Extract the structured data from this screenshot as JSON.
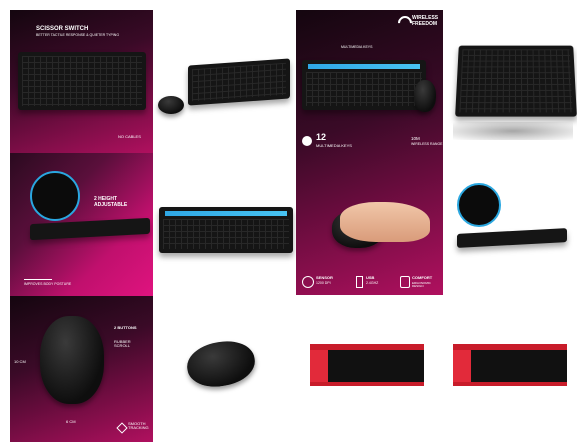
{
  "tiles": {
    "t1": {
      "title": "Scissor Switch",
      "subtitle": "Better Tactile Response & Quieter Typing",
      "badge": "No Cables"
    },
    "t3": {
      "title": "Wireless Freedom",
      "multimedia_label": "Multimedia Keys",
      "keys_count": "12",
      "keys_label": "Multimedia Keys",
      "range_value": "10m",
      "range_label": "Wireless Range"
    },
    "t5": {
      "height_label": "2 Height Adjustable",
      "posture_label": "Improves Body Posture"
    },
    "t7": {
      "sensor_title": "Sensor",
      "sensor_value": "1200 dpi",
      "usb_title": "USB",
      "usb_value": "2.4GHz",
      "comfort_title": "Comfort",
      "comfort_value": "Ergonomic Design"
    },
    "t9": {
      "size_height": "10 cm",
      "size_width": "6 cm",
      "rubber_label": "Rubber Scroll",
      "smooth_label": "Smooth Tracking",
      "scroll_label": "2 Buttons"
    }
  },
  "colors": {
    "magenta": "#e0137f",
    "accent_blue": "#2aa7e0",
    "box_red": "#c81c2a"
  },
  "icons": [
    "ngs-logo",
    "wifi-icon",
    "usb-icon",
    "thumbs-up-icon",
    "move-icon"
  ]
}
